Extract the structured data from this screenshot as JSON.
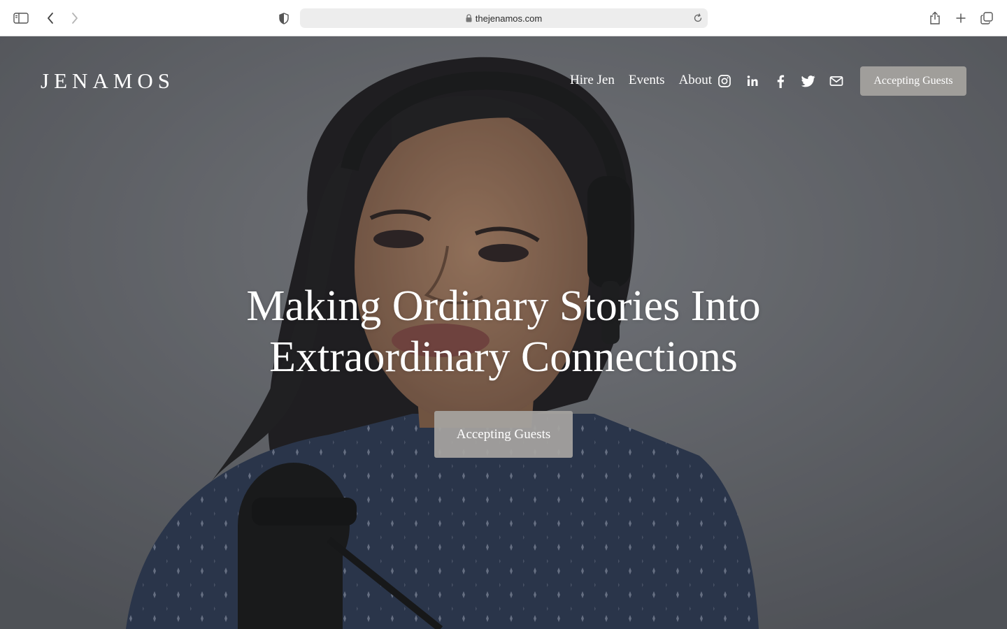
{
  "browser": {
    "url": "thejenamos.com",
    "icons": {
      "sidebar": "sidebar-icon",
      "back": "back-chevron-icon",
      "forward": "forward-chevron-icon",
      "privacy": "shield-icon",
      "lock": "lock-icon",
      "reload": "reload-icon",
      "share": "share-icon",
      "new_tab": "plus-icon",
      "tabs": "tab-overview-icon"
    }
  },
  "site": {
    "logo": "JENAMOS",
    "nav": [
      {
        "label": "Hire Jen"
      },
      {
        "label": "Events"
      },
      {
        "label": "About"
      }
    ],
    "social": [
      "instagram-icon",
      "linkedin-icon",
      "facebook-icon",
      "twitter-icon",
      "email-icon"
    ],
    "header_cta": "Accepting Guests"
  },
  "hero": {
    "title_line1": "Making Ordinary Stories Into",
    "title_line2": "Extraordinary Connections",
    "cta": "Accepting Guests"
  },
  "colors": {
    "button_bg": "#a6a4a0",
    "text": "#ffffff",
    "background": "#77797e"
  }
}
